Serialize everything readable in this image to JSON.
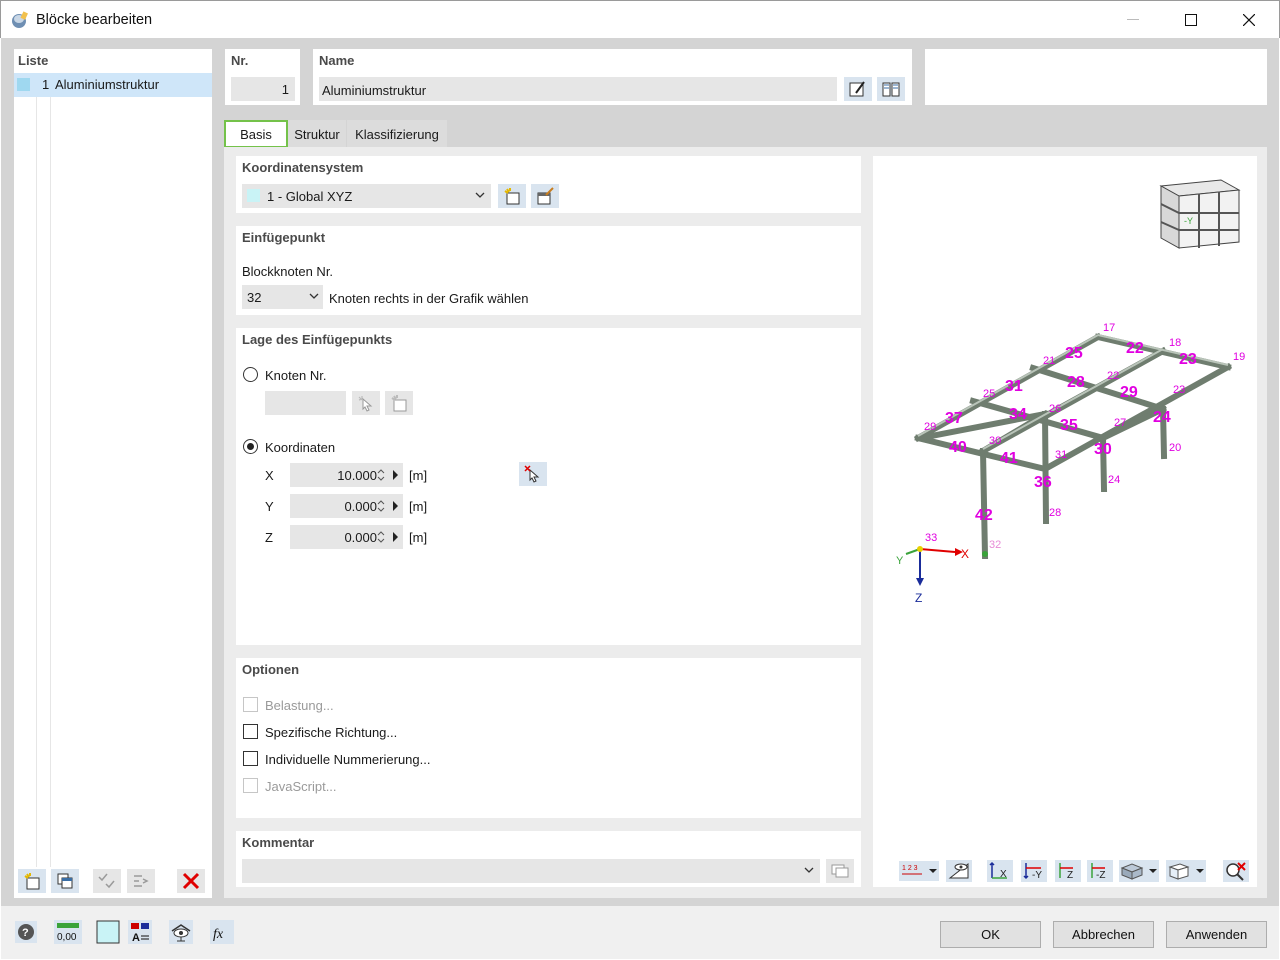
{
  "window": {
    "title": "Blöcke bearbeiten"
  },
  "list": {
    "header": "Liste",
    "items": [
      {
        "number": "1",
        "label": "Aluminiumstruktur",
        "color": "#9fd8f0"
      }
    ]
  },
  "nr": {
    "label": "Nr.",
    "value": "1"
  },
  "name": {
    "label": "Name",
    "value": "Aluminiumstruktur"
  },
  "tabs": [
    {
      "label": "Basis",
      "active": true
    },
    {
      "label": "Struktur",
      "active": false
    },
    {
      "label": "Klassifizierung",
      "active": false
    }
  ],
  "coordsys": {
    "title": "Koordinatensystem",
    "selected": "1 - Global XYZ"
  },
  "insert_point": {
    "title": "Einfügepunkt",
    "block_node_label": "Blockknoten Nr.",
    "block_node_value": "32",
    "hint": "Knoten rechts in der Grafik wählen"
  },
  "position": {
    "title": "Lage des Einfügepunkts",
    "node_option": "Knoten Nr.",
    "coords_option": "Koordinaten",
    "selected_option": "Koordinaten",
    "coords": [
      {
        "axis": "X",
        "value": "10.000",
        "unit": "[m]"
      },
      {
        "axis": "Y",
        "value": "0.000",
        "unit": "[m]"
      },
      {
        "axis": "Z",
        "value": "0.000",
        "unit": "[m]"
      }
    ]
  },
  "options": {
    "title": "Optionen",
    "items": [
      {
        "label": "Belastung...",
        "enabled": false,
        "checked": false
      },
      {
        "label": "Spezifische Richtung...",
        "enabled": true,
        "checked": false
      },
      {
        "label": "Individuelle Nummerierung...",
        "enabled": true,
        "checked": false
      },
      {
        "label": "JavaScript...",
        "enabled": false,
        "checked": false
      }
    ]
  },
  "comment": {
    "title": "Kommentar",
    "value": ""
  },
  "graphic": {
    "axis_labels": {
      "x": "X",
      "y": "Y",
      "z": "Z"
    },
    "origin_node": "33",
    "insert_node": "32",
    "node_labels": [
      "17",
      "18",
      "19",
      "20",
      "21",
      "22",
      "23",
      "24",
      "25",
      "26",
      "27",
      "28",
      "29",
      "30",
      "31",
      "32",
      "33"
    ],
    "member_labels": [
      "22",
      "23",
      "24",
      "25",
      "28",
      "29",
      "30",
      "31",
      "34",
      "35",
      "36",
      "37",
      "40",
      "41",
      "42"
    ],
    "view_cube_label": "-Y",
    "toolbar_icons": [
      "numbering-icon",
      "visibility-icon",
      "view-x-icon",
      "view-minus-y-icon",
      "view-z-icon",
      "view-minus-z-icon",
      "render-mode-icon",
      "display-box-icon",
      "reset-selection-icon"
    ]
  },
  "buttons": {
    "ok": "OK",
    "cancel": "Abbrechen",
    "apply": "Anwenden"
  },
  "footer_icons": [
    "help-icon",
    "units-icon",
    "color-icon",
    "text-format-icon",
    "view-icon",
    "formula-icon"
  ],
  "units_icon_text": "0,00",
  "formula_icon_text": "fx",
  "accent_color": "#74c24a",
  "node_label_color": "#e000e0"
}
